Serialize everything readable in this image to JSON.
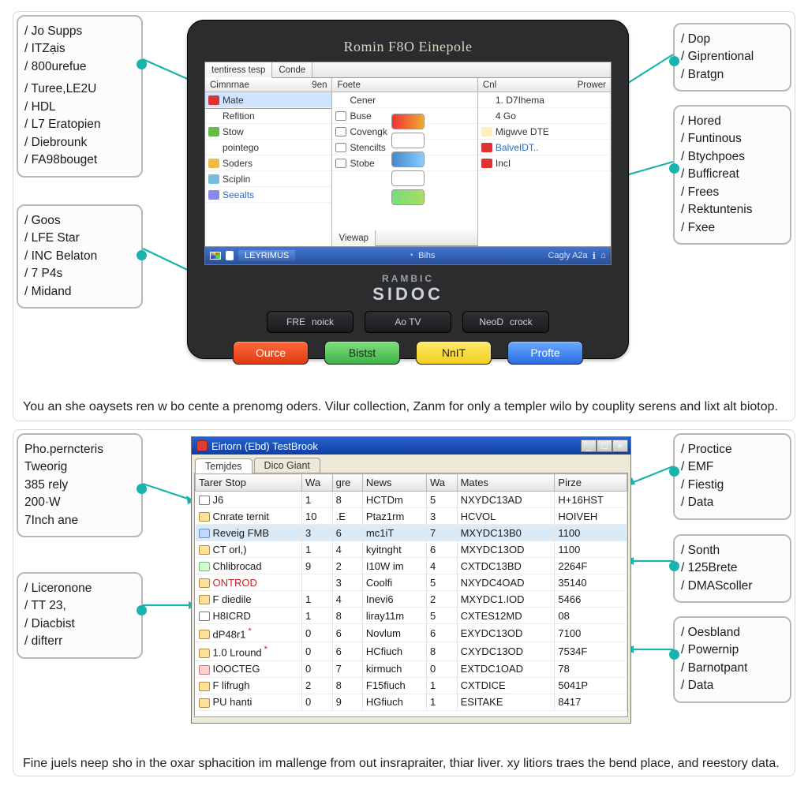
{
  "top": {
    "device_title": "Romin F8O Einepole",
    "screen": {
      "tabs": [
        "tentiress tesp",
        "Conde"
      ],
      "pane1": {
        "header": "Cimnrnae",
        "header_b": "9en",
        "items": [
          "Mate",
          "Refition",
          "Stow",
          "pointego",
          "Soders",
          "Sciplin",
          "Seealts"
        ]
      },
      "pane2": {
        "header": "Foete",
        "items": [
          "Cener",
          "Buse",
          "Covengk",
          "Stencilts",
          "Stobe"
        ],
        "footer_tab": "Viewap"
      },
      "pane3": {
        "header_a": "Cnl",
        "header_b": "Prower",
        "items": [
          "1. D7Ihema",
          "4    Go",
          "Migwve DTE",
          "BalveIDT..",
          "IncI"
        ]
      },
      "taskbar_left": "LEYRIMUS",
      "taskbar_mid": "Bihs",
      "taskbar_right": "Cagly A2a"
    },
    "logo_top": "RAMBIC",
    "logo_bottom": "SIDOC",
    "hard_buttons": [
      {
        "a": "FRE",
        "b": "noick"
      },
      {
        "a": "",
        "b": "Ao TV"
      },
      {
        "a": "NeoD",
        "b": "crock"
      }
    ],
    "color_buttons": {
      "red": "Ource",
      "green": "Bistst",
      "yellow": "NnIT",
      "blue": "Profte"
    },
    "caption": "You an she oaysets ren w bo cente a prenomg oders. Vilur collection, Zanm for only a templer wilo by couplity serens and lixt alt biotop.",
    "callouts": {
      "top_left": [
        "Jo Supps",
        "ITZạis",
        "800urefue",
        "Turee,LE2U",
        "HDL",
        "L7 Eratopien",
        "Diebrounk",
        "FA98bouget"
      ],
      "mid_left": [
        "Goos",
        "LFE Star",
        "INC Belaton",
        "7 P4s",
        "Midand"
      ],
      "top_right": [
        "Dop",
        "Giprentional",
        "Bratgn"
      ],
      "mid_right": [
        "Hored",
        "Funtinous",
        "Btychpoes",
        "Bufficreat",
        "Frees",
        "Rektuntenis",
        "Fxee"
      ]
    }
  },
  "bottom": {
    "window_title": "Eirtorn (Ebd) TestBrook",
    "win_tabs": [
      "Temjdes",
      "Dico Giant"
    ],
    "columns": [
      "Tarer Stop",
      "Wa",
      "gre",
      "News",
      "Wa",
      "Mates",
      "Pirze"
    ],
    "rows": [
      {
        "ico": "doc",
        "c": [
          "J6",
          "1",
          "8",
          "HCTDm",
          "5",
          "NXYDC13AD",
          "H+16HST"
        ]
      },
      {
        "ico": "fol",
        "c": [
          "Cnrate ternit",
          "10",
          ".E",
          "Ptaz1rm",
          "3",
          "HCVOL",
          "HOIVEH"
        ]
      },
      {
        "ico": "img",
        "c": [
          "Reveig FMB",
          "3",
          "6",
          "mc1iT",
          "7",
          "MXYDC13B0",
          "1100"
        ],
        "hl": true
      },
      {
        "ico": "fol",
        "c": [
          "CT orl,)",
          "1",
          "4",
          "kyitnght",
          "6",
          "MXYDC13OD",
          "1100"
        ]
      },
      {
        "ico": "aud",
        "c": [
          "Chlibrocad",
          "9",
          "2",
          "I10W im",
          "4",
          "CXTDC13BD",
          "2264F"
        ]
      },
      {
        "ico": "fol",
        "c": [
          "ONTROD",
          "",
          "3",
          "Coolfi",
          "5",
          "NXYDC4OAD",
          "35140"
        ],
        "red": true
      },
      {
        "ico": "fol",
        "c": [
          "F diedile",
          "1",
          "4",
          "Inevi6",
          "2",
          "MXYDC1.IOD",
          "5466"
        ]
      },
      {
        "ico": "doc",
        "c": [
          "H8ICRD",
          "1",
          "8",
          "liray11m",
          "5",
          "CXTES12MD",
          "08"
        ]
      },
      {
        "ico": "fol",
        "c": [
          "dP48r1",
          "0",
          "6",
          "Novlum",
          "6",
          "EXYDC13OD",
          "7100"
        ],
        "ast": true
      },
      {
        "ico": "fol",
        "c": [
          "1.0 Lround",
          "0",
          "6",
          "HCfiuch",
          "8",
          "CXYDC13OD",
          "7534F"
        ],
        "ast": true
      },
      {
        "ico": "bin",
        "c": [
          "IOOCTEG",
          "0",
          "7",
          "kirmuch",
          "0",
          "EXTDC1OAD",
          "78"
        ]
      },
      {
        "ico": "fol",
        "c": [
          "F lifrugh",
          "2",
          "8",
          "F15fiuch",
          "1",
          "CXTDICE",
          "5041P"
        ]
      },
      {
        "ico": "fol",
        "c": [
          "PU hanti",
          "0",
          "9",
          "HGfiuch",
          "1",
          "ESITAKE",
          "8417"
        ]
      }
    ],
    "caption": "Fine juels neep sho in the oxar sphacition im mallenge from out insrapraiter, thiar liver. xy litiors traes the bend place, and reestory data.",
    "callouts": {
      "top_left": {
        "title": "Pho.perncteris Tweorig",
        "lines": [
          "385 rely",
          "200·W",
          "7Inch ane"
        ]
      },
      "bot_left": [
        "Liceronone",
        "TT 23,",
        "Diacbist",
        "difterr"
      ],
      "top_right": [
        "Proctice",
        "EMF",
        "Fiestig",
        "Data"
      ],
      "mid_right": [
        "Sonth",
        "125Brete",
        "DMAScoller"
      ],
      "bot_right": [
        "Oesbland",
        "Powernip",
        "Barnotpant",
        "Data"
      ]
    }
  }
}
